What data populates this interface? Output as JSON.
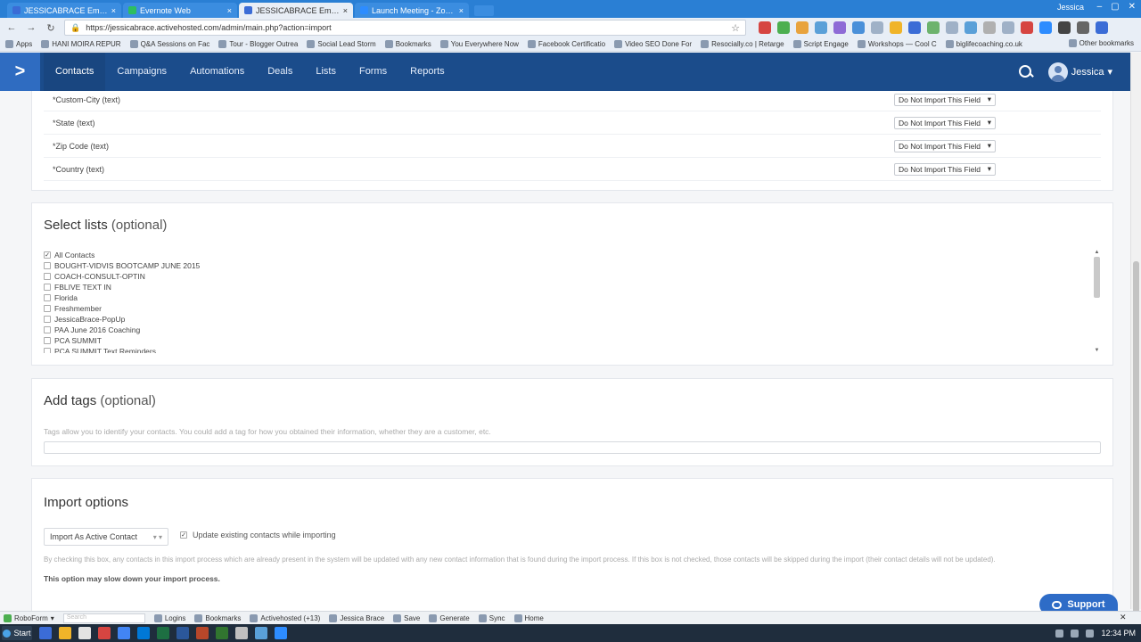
{
  "browser": {
    "tabs": [
      {
        "title": "JESSICABRACE Email Ma",
        "color": "#3b6cd6",
        "active": false
      },
      {
        "title": "Evernote Web",
        "color": "#2dbe60",
        "active": false
      },
      {
        "title": "JESSICABRACE Email Ma",
        "color": "#3b6cd6",
        "active": true
      },
      {
        "title": "Launch Meeting - Zoom",
        "color": "#2d8cff",
        "active": false
      }
    ],
    "user": "Jessica",
    "url": "https://jessicabrace.activehosted.com/admin/main.php?action=import",
    "bookmarks": [
      "Apps",
      "HANI MOIRA REPUR",
      "Q&A Sessions on Fac",
      "Tour - Blogger Outrea",
      "Social Lead Storm",
      "Bookmarks",
      "You Everywhere Now",
      "Facebook Certificatio",
      "Video SEO Done For",
      "Resocially.co | Retarge",
      "Script Engage",
      "Workshops — Cool C",
      "biglifecoaching.co.uk"
    ],
    "other_bookmarks": "Other bookmarks"
  },
  "header": {
    "logo": ">",
    "nav": [
      {
        "label": "Contacts",
        "active": true
      },
      {
        "label": "Campaigns",
        "active": false
      },
      {
        "label": "Automations",
        "active": false
      },
      {
        "label": "Deals",
        "active": false
      },
      {
        "label": "Lists",
        "active": false
      },
      {
        "label": "Forms",
        "active": false
      },
      {
        "label": "Reports",
        "active": false
      }
    ],
    "user_name": "Jessica"
  },
  "fields": [
    {
      "name": "*Custom-City (text)",
      "value": "Do Not Import This Field"
    },
    {
      "name": "*State (text)",
      "value": "Do Not Import This Field"
    },
    {
      "name": "*Zip Code (text)",
      "value": "Do Not Import This Field"
    },
    {
      "name": "*Country (text)",
      "value": "Do Not Import This Field"
    }
  ],
  "select_lists": {
    "title": "Select lists",
    "optional": "(optional)",
    "items": [
      {
        "label": "All Contacts",
        "checked": true
      },
      {
        "label": "BOUGHT-VIDVIS BOOTCAMP JUNE 2015",
        "checked": false
      },
      {
        "label": "COACH-CONSULT-OPTIN",
        "checked": false
      },
      {
        "label": "FBLIVE TEXT IN",
        "checked": false
      },
      {
        "label": "Florida",
        "checked": false
      },
      {
        "label": "Freshmember",
        "checked": false
      },
      {
        "label": "JessicaBrace-PopUp",
        "checked": false
      },
      {
        "label": "PAA June 2016 Coaching",
        "checked": false
      },
      {
        "label": "PCA SUMMIT",
        "checked": false
      },
      {
        "label": "PCA SUMMIT Text Reminders",
        "checked": false
      }
    ]
  },
  "tags": {
    "title": "Add tags",
    "optional": "(optional)",
    "hint": "Tags allow you to identify your contacts. You could add a tag for how you obtained their information, whether they are a customer, etc."
  },
  "import_options": {
    "title": "Import options",
    "import_as": "Import As Active Contact",
    "update_label": "Update existing contacts while importing",
    "update_checked": true,
    "hint": "By checking this box, any contacts in this import process which are already present in the system will be updated with any new contact information that is found during the import process. If this box is not checked, those contacts will be skipped during the import (their contact details will not be updated).",
    "warning": "This option may slow down your import process."
  },
  "support": {
    "label": "Support"
  },
  "roboform": {
    "brand": "RoboForm",
    "search_placeholder": "Search",
    "items": [
      "Logins",
      "Bookmarks",
      "Activehosted (+13)",
      "Jessica Brace",
      "Save",
      "Generate",
      "Sync",
      "Home"
    ]
  },
  "taskbar": {
    "start": "Start",
    "icon_colors": [
      "#3b6cd6",
      "#f0b429",
      "#e3e3e3",
      "#d64541",
      "#4285f4",
      "#0078d7",
      "#1d6f42",
      "#2b579a",
      "#b7472a",
      "#31752f",
      "#c0c0c0",
      "#5aa0d8",
      "#2d8cff"
    ],
    "time": "12:34 PM"
  }
}
